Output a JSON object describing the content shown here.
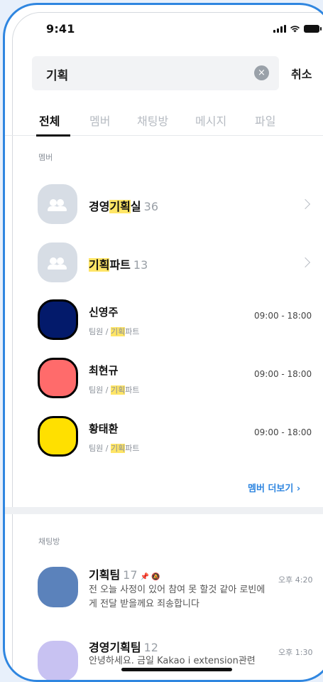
{
  "status": {
    "time": "9:41"
  },
  "search": {
    "query": "기획",
    "clear_icon": "×",
    "cancel_label": "취소"
  },
  "tabs": [
    {
      "label": "전체",
      "active": true
    },
    {
      "label": "멤버"
    },
    {
      "label": "채팅방"
    },
    {
      "label": "메시지"
    },
    {
      "label": "파일"
    }
  ],
  "members_section": {
    "title": "멤버",
    "groups": [
      {
        "pre": "경영",
        "hl": "기획",
        "post": "실",
        "count": "36"
      },
      {
        "pre": "",
        "hl": "기획",
        "post": "파트",
        "count": "13"
      }
    ],
    "people": [
      {
        "name": "신영주",
        "sub_pre": "팀원 / ",
        "sub_hl": "기획",
        "sub_post": "파트",
        "hours": "09:00 - 18:00",
        "color": "#031a6b"
      },
      {
        "name": "최현규",
        "sub_pre": "팀원 / ",
        "sub_hl": "기획",
        "sub_post": "파트",
        "hours": "09:00 - 18:00",
        "color": "#ff6b6b"
      },
      {
        "name": "황태환",
        "sub_pre": "팀원 / ",
        "sub_hl": "기획",
        "sub_post": "파트",
        "hours": "09:00 - 18:00",
        "color": "#ffe000"
      }
    ],
    "more_label": "멤버 더보기 ›"
  },
  "chats_section": {
    "title": "채팅방",
    "rooms": [
      {
        "name": "기획팀",
        "count": "17",
        "icons": "📌 🔕",
        "time": "오후 4:20",
        "message": "전 오늘 사정이 있어 참여 못 할것 같아 로빈에게 전달 받을께요 죄송합니다",
        "color": "#5b82bb"
      },
      {
        "name": "경영기획팀",
        "count": "12",
        "time": "오후 1:30",
        "message": "안녕하세요. 금일 Kakao i extension관련 논의된 내용 정리하여 공유 드립니다",
        "color": "#c8c2f2"
      }
    ]
  }
}
